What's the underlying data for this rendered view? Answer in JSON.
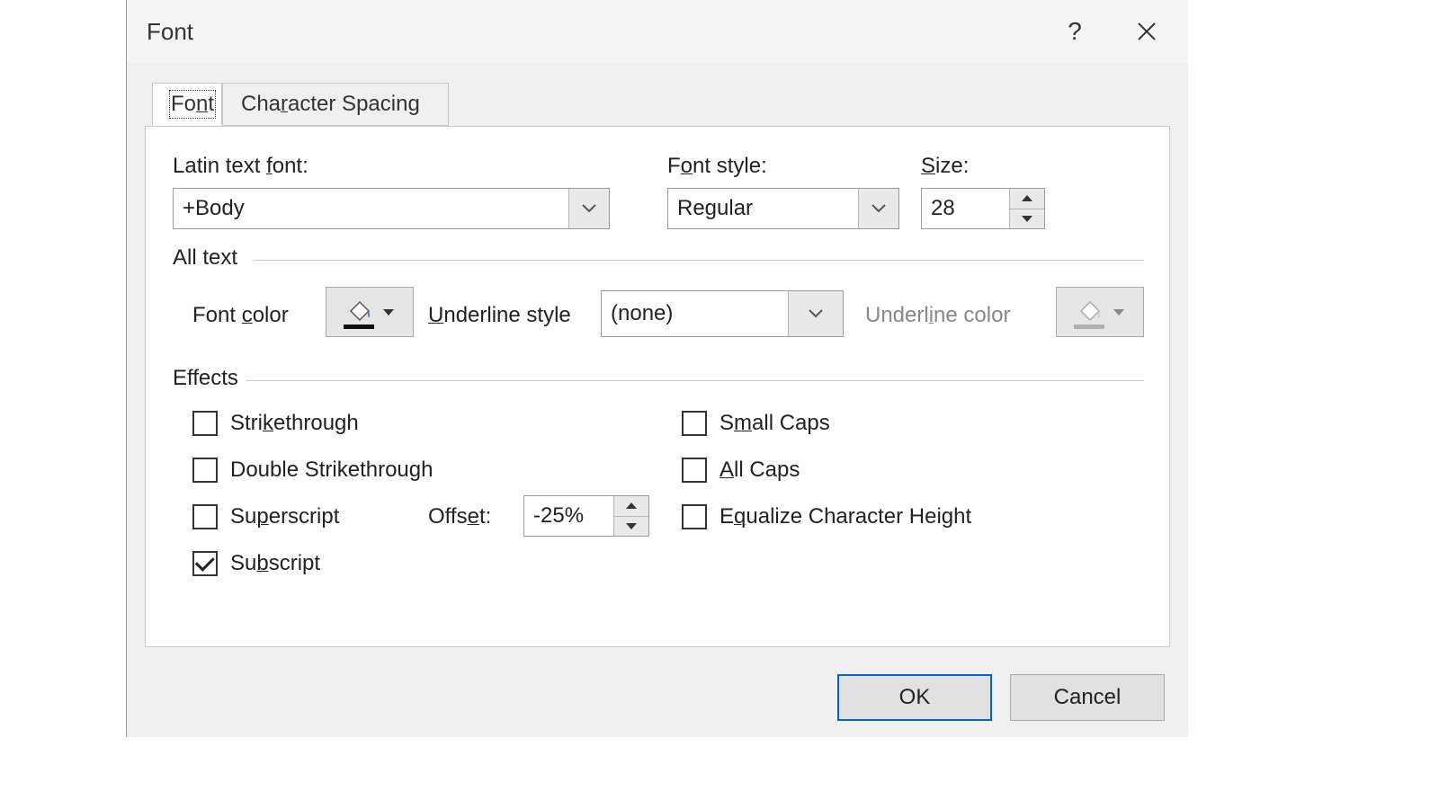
{
  "titlebar": {
    "title": "Font"
  },
  "tabs": {
    "font": "Font",
    "spacing": "Character Spacing"
  },
  "row1": {
    "latin_label_pre": "Latin text ",
    "latin_label_u": "f",
    "latin_label_post": "ont:",
    "style_label_pre": "F",
    "style_label_u": "o",
    "style_label_post": "nt style:",
    "size_label_u": "S",
    "size_label_post": "ize:",
    "latin_value": "+Body",
    "style_value": "Regular",
    "size_value": "28"
  },
  "alltext": {
    "group": "All text",
    "fontcolor_pre": "Font ",
    "fontcolor_u": "c",
    "fontcolor_post": "olor",
    "ustyle_u": "U",
    "ustyle_post": "nderline style",
    "ustyle_value": "(none)",
    "ucolor_pre": "Underl",
    "ucolor_u": "i",
    "ucolor_post": "ne color"
  },
  "effects": {
    "group": "Effects",
    "strike_pre": "Stri",
    "strike_u": "k",
    "strike_post": "ethrough",
    "dstrike": "Double Strikethrough",
    "super_pre": "Su",
    "super_u": "p",
    "super_post": "erscript",
    "sub_pre": "Su",
    "sub_u": "b",
    "sub_post": "script",
    "offset_pre": "Offs",
    "offset_u": "e",
    "offset_post": "t:",
    "offset_value": "-25%",
    "small_pre": "S",
    "small_u": "m",
    "small_post": "all Caps",
    "all_u": "A",
    "all_post": "ll Caps",
    "eq_pre": "E",
    "eq_u": "q",
    "eq_post": "ualize Character Height"
  },
  "footer": {
    "ok": "OK",
    "cancel": "Cancel"
  },
  "state": {
    "subscript_checked": true
  }
}
